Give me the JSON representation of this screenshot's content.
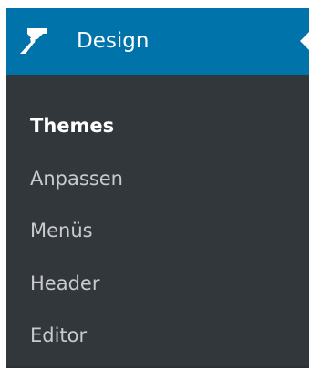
{
  "menu": {
    "title": "Design",
    "icon": "paintbrush-icon",
    "colors": {
      "header_bg": "#0073aa",
      "menu_bg": "#32373c",
      "item_text": "#c8cacc",
      "current_text": "#ffffff"
    },
    "items": [
      {
        "label": "Themes",
        "current": true
      },
      {
        "label": "Anpassen",
        "current": false
      },
      {
        "label": "Menüs",
        "current": false
      },
      {
        "label": "Header",
        "current": false
      },
      {
        "label": "Editor",
        "current": false
      }
    ]
  }
}
